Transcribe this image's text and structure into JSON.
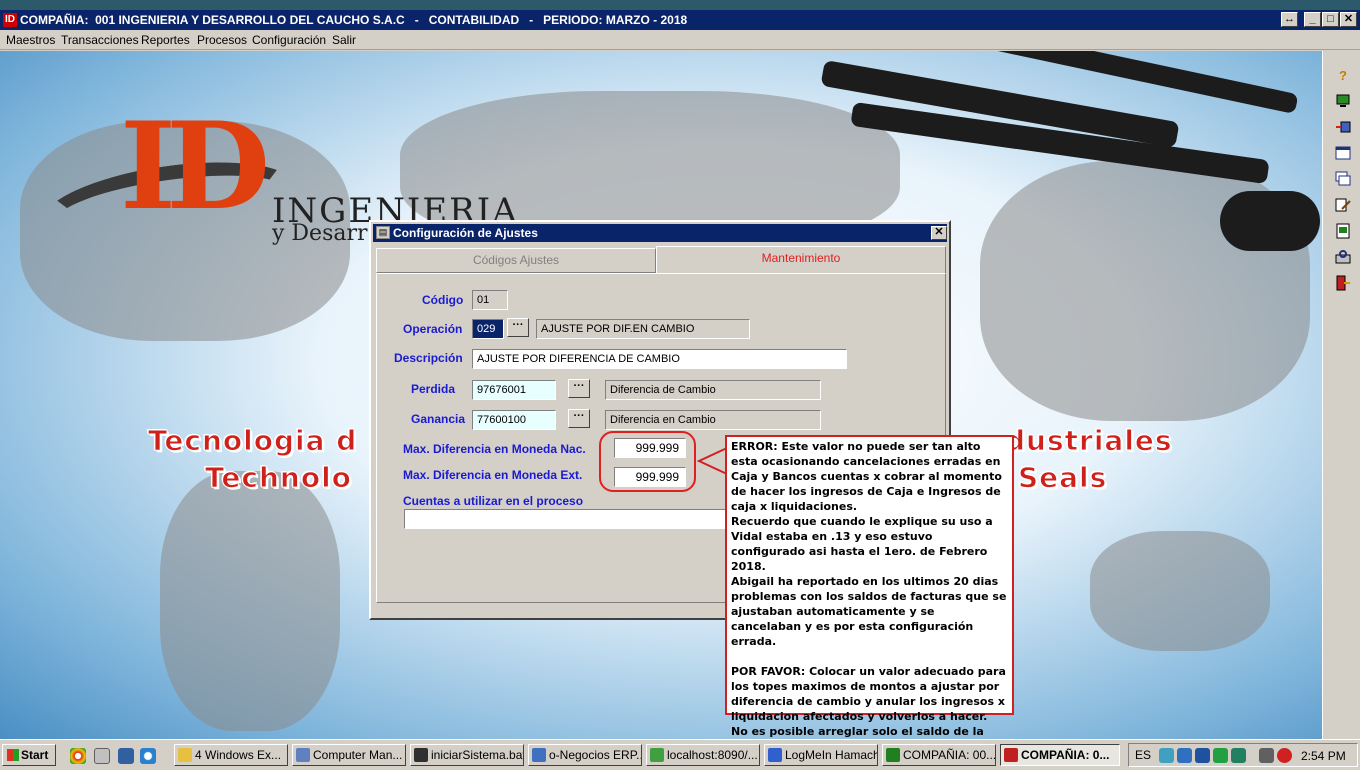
{
  "window": {
    "title": "COMPAÑIA:  001 INGENIERIA Y DESARROLLO DEL CAUCHO S.A.C   -   CONTABILIDAD   -   PERIODO: MARZO - 2018",
    "icon_text": "ID"
  },
  "menu": [
    "Maestros",
    "Transacciones",
    "Reportes",
    "Procesos",
    "Configuración",
    "Salir"
  ],
  "background": {
    "logo_letters": "ID",
    "logo_name": "INGENIERIA",
    "logo_sub": "y Desarr",
    "slogan_line1_left": "Tecnologia d",
    "slogan_line1_right": "dustriales",
    "slogan_line2_left": "Technolo",
    "slogan_line2_right": "Seals"
  },
  "dialog": {
    "title": "Configuración de Ajustes",
    "tabs": [
      {
        "label": "Códigos Ajustes",
        "color": "#808080"
      },
      {
        "label": "Mantenimiento",
        "color": "#e02020"
      }
    ],
    "codigo": {
      "label": "Código",
      "value": "01"
    },
    "operacion": {
      "label": "Operación",
      "code": "029",
      "desc": "AJUSTE POR DIF.EN CAMBIO"
    },
    "descripcion": {
      "label": "Descripción",
      "value": "AJUSTE POR DIFERENCIA DE CAMBIO"
    },
    "perdida": {
      "label": "Perdida",
      "account": "97676001",
      "desc": "Diferencia de Cambio"
    },
    "ganancia": {
      "label": "Ganancia",
      "account": "77600100",
      "desc": "Diferencia en Cambio"
    },
    "max_nac": {
      "label": "Max. Diferencia en Moneda Nac.",
      "value": "999.999"
    },
    "max_ext": {
      "label": "Max. Diferencia en Moneda Ext.",
      "value": "999.999"
    },
    "cuentas": {
      "label": "Cuentas a utilizar en el proceso",
      "value": ""
    },
    "ellipsis": "···"
  },
  "annotation": {
    "text": "ERROR: Este valor no puede ser tan alto esta ocasionando cancelaciones erradas en Caja y Bancos cuentas x cobrar al momento de hacer los ingresos de Caja e Ingresos de caja x liquidaciones.\nRecuerdo que cuando le explique su uso a Vidal estaba en .13 y eso estuvo configurado asi hasta el 1ero. de Febrero 2018.\nAbigail ha reportado en los ultimos 20 dias problemas con los saldos de facturas que se ajustaban automaticamente y se cancelaban y es por esta configuración errada.\n\nPOR FAVOR: Colocar un valor adecuado para los topes maximos de montos a ajustar por diferencia de cambio y anular los ingresos x liquidacion afectados y volverlos a hacer.\nNo es posible arreglar solo el saldo de la factura afectada por que el problema seguiria ocurriendo.",
    "color": "#d02020"
  },
  "taskbar": {
    "start": "Start",
    "tasks": [
      {
        "label": "4 Windows Ex...",
        "color": "#e8c040"
      },
      {
        "label": "Computer Man...",
        "color": "#6080c0"
      },
      {
        "label": "iniciarSistema.bat",
        "color": "#303030"
      },
      {
        "label": "o-Negocios ERP...",
        "color": "#4070c0"
      },
      {
        "label": "localhost:8090/...",
        "color": "#40a040"
      },
      {
        "label": "LogMeIn Hamachi",
        "color": "#3060d0"
      },
      {
        "label": "COMPAÑIA:  00...",
        "color": "#208020"
      },
      {
        "label": "COMPAÑIA:  0...",
        "color": "#c02020"
      }
    ],
    "language": "ES",
    "clock": "2:54 PM"
  }
}
